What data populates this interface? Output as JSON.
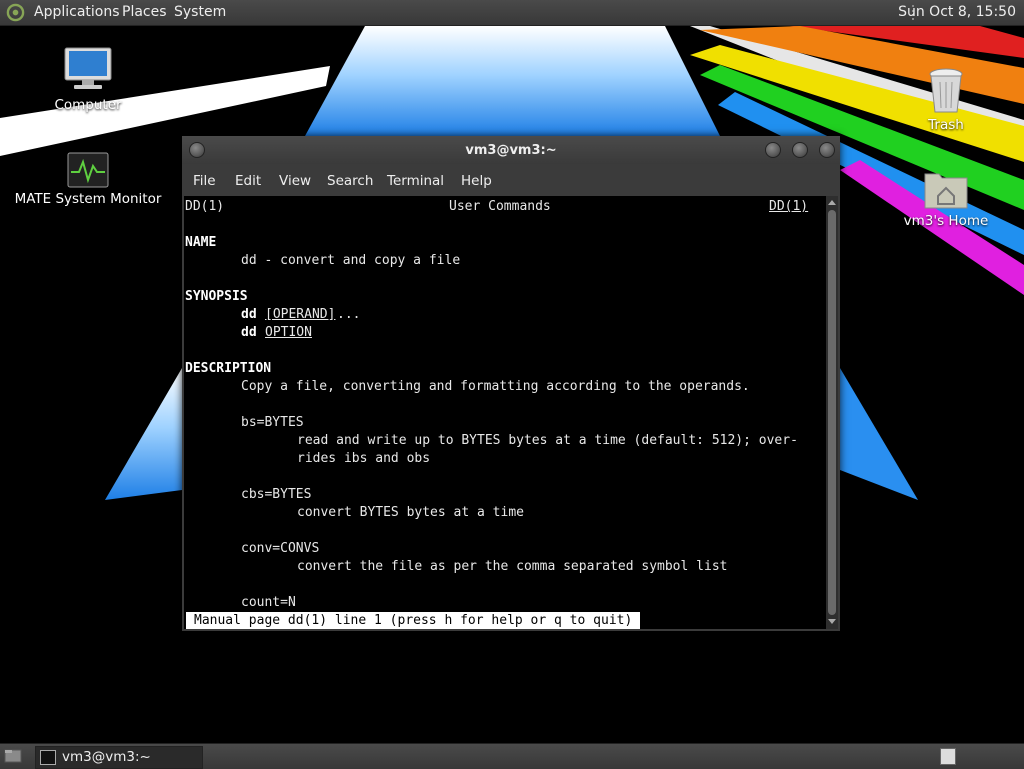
{
  "top_panel": {
    "menus": [
      "Applications",
      "Places",
      "System"
    ],
    "clock": "Sun Oct  8, 15:50"
  },
  "desktop_icons": {
    "computer": "Computer",
    "system_monitor": "MATE System Monitor",
    "trash": "Trash",
    "home": "vm3's Home"
  },
  "terminal": {
    "title": "vm3@vm3:~",
    "menu": [
      "File",
      "Edit",
      "View",
      "Search",
      "Terminal",
      "Help"
    ],
    "man": {
      "header_left": "DD(1)",
      "header_center": "User Commands",
      "header_right": "DD(1)",
      "name_heading": "NAME",
      "name_line": "dd - convert and copy a file",
      "synopsis_heading": "SYNOPSIS",
      "syn1_cmd": "dd",
      "syn1_arg": "[OPERAND]",
      "syn1_tail": "...",
      "syn2_cmd": "dd",
      "syn2_arg": "OPTION",
      "description_heading": "DESCRIPTION",
      "desc_line": "Copy a file, converting and formatting according to the operands.",
      "bs_opt": "bs=BYTES",
      "bs_desc1": "read and write up to BYTES bytes at a time (default: 512); over-",
      "bs_desc2": "rides ibs and obs",
      "cbs_opt": "cbs=BYTES",
      "cbs_desc": "convert BYTES bytes at a time",
      "conv_opt": "conv=CONVS",
      "conv_desc": "convert the file as per the comma separated symbol list",
      "count_opt": "count=N"
    },
    "status": "Manual page dd(1) line 1 (press h for help or q to quit)"
  },
  "bottom_panel": {
    "task_label": "vm3@vm3:~"
  },
  "colors": {
    "panel": "#3c3c3c",
    "wallpaper_beam": "#ffffff",
    "wallpaper_triangle": "#1e90ff",
    "rainbow": [
      "#e02020",
      "#f08010",
      "#f0e000",
      "#20d020",
      "#2090f0",
      "#e020e0"
    ]
  }
}
